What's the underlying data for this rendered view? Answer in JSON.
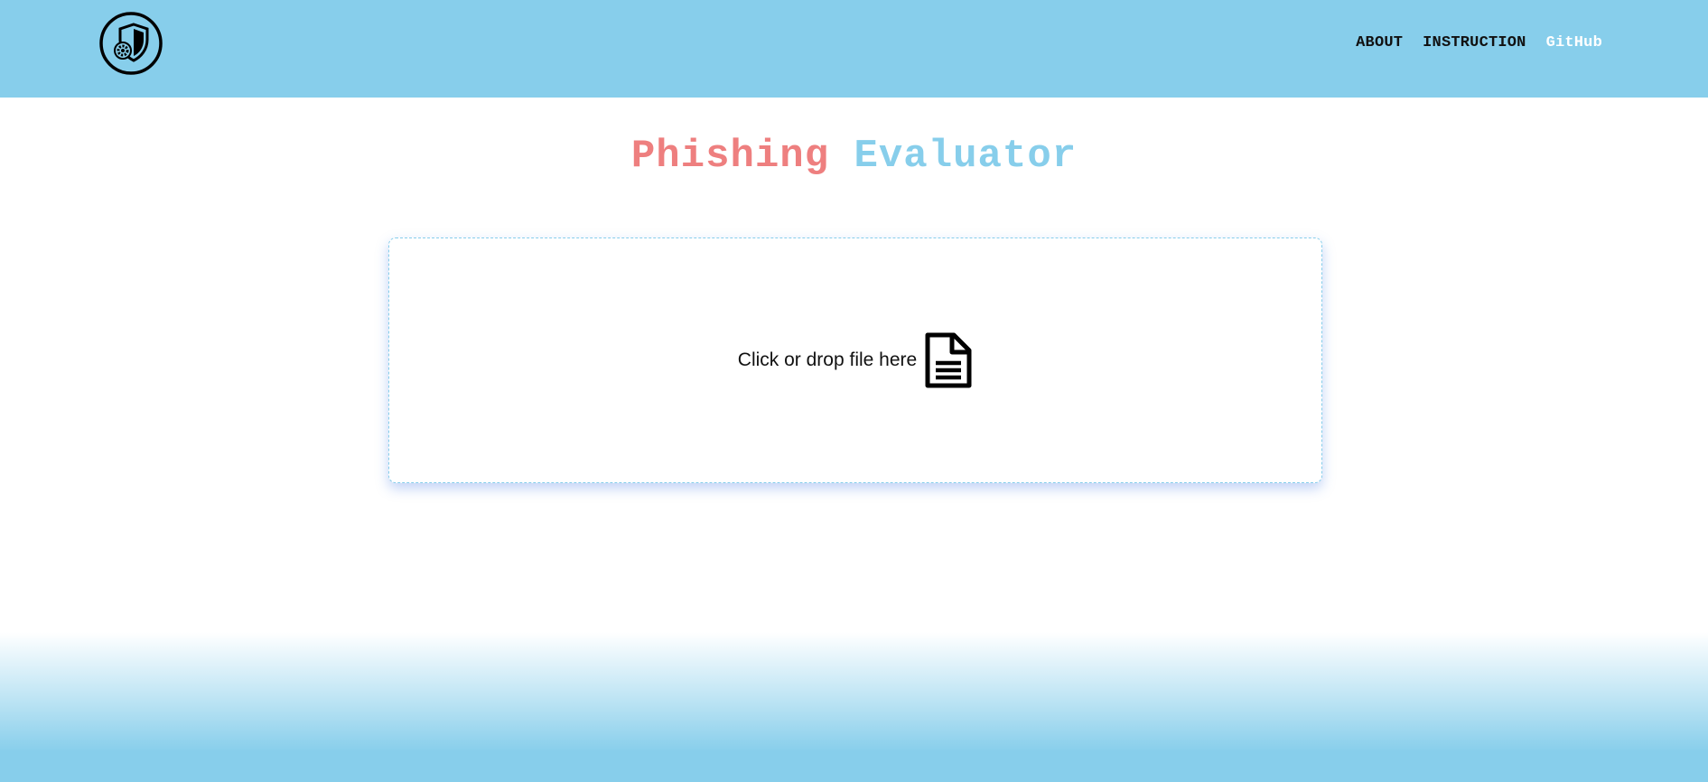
{
  "header": {
    "logo_icon": "shield-gear-logo-icon",
    "background_color": "#87ceeb",
    "nav": [
      {
        "label": "ABOUT"
      },
      {
        "label": "INSTRUCTION"
      },
      {
        "label": "GitHub"
      }
    ]
  },
  "main": {
    "title_word1": "Phishing",
    "title_word2": "Evaluator",
    "title_color1": "#ee7f7f",
    "title_color2": "#87ceeb",
    "dropzone": {
      "label": "Click or drop file here",
      "icon": "file-document-icon"
    }
  }
}
